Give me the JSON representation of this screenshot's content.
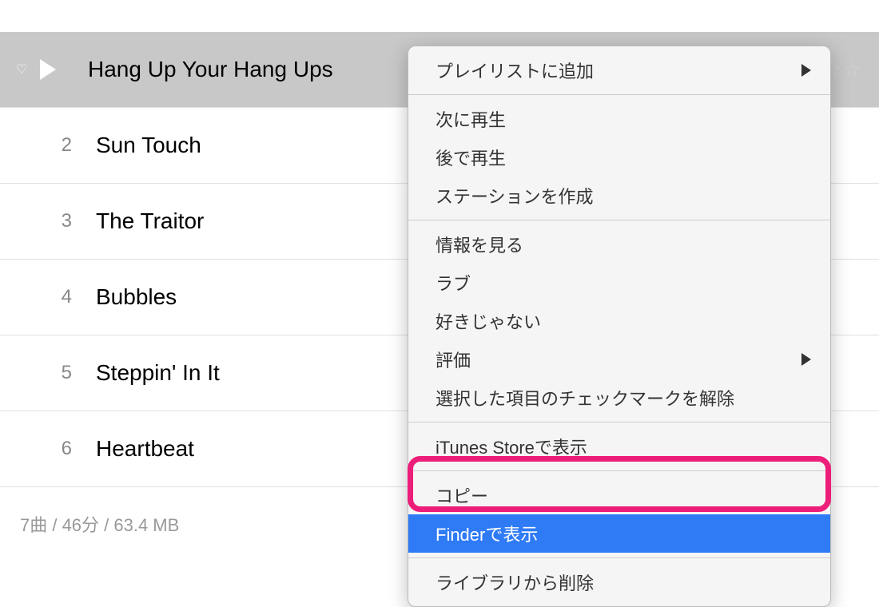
{
  "tracks": [
    {
      "number": "",
      "title": "Hang Up Your Hang Ups"
    },
    {
      "number": "2",
      "title": "Sun Touch"
    },
    {
      "number": "3",
      "title": "The Traitor"
    },
    {
      "number": "4",
      "title": "Bubbles"
    },
    {
      "number": "5",
      "title": "Steppin' In It"
    },
    {
      "number": "6",
      "title": "Heartbeat"
    }
  ],
  "stars": "☆☆☆",
  "footer": "7曲 / 46分 / 63.4 MB",
  "menu": {
    "add_to_playlist": "プレイリストに追加",
    "play_next": "次に再生",
    "play_later": "後で再生",
    "create_station": "ステーションを作成",
    "get_info": "情報を見る",
    "love": "ラブ",
    "dislike": "好きじゃない",
    "rating": "評価",
    "uncheck": "選択した項目のチェックマークを解除",
    "show_in_store": "iTunes Storeで表示",
    "copy": "コピー",
    "show_in_finder": "Finderで表示",
    "remove_from_library": "ライブラリから削除"
  }
}
